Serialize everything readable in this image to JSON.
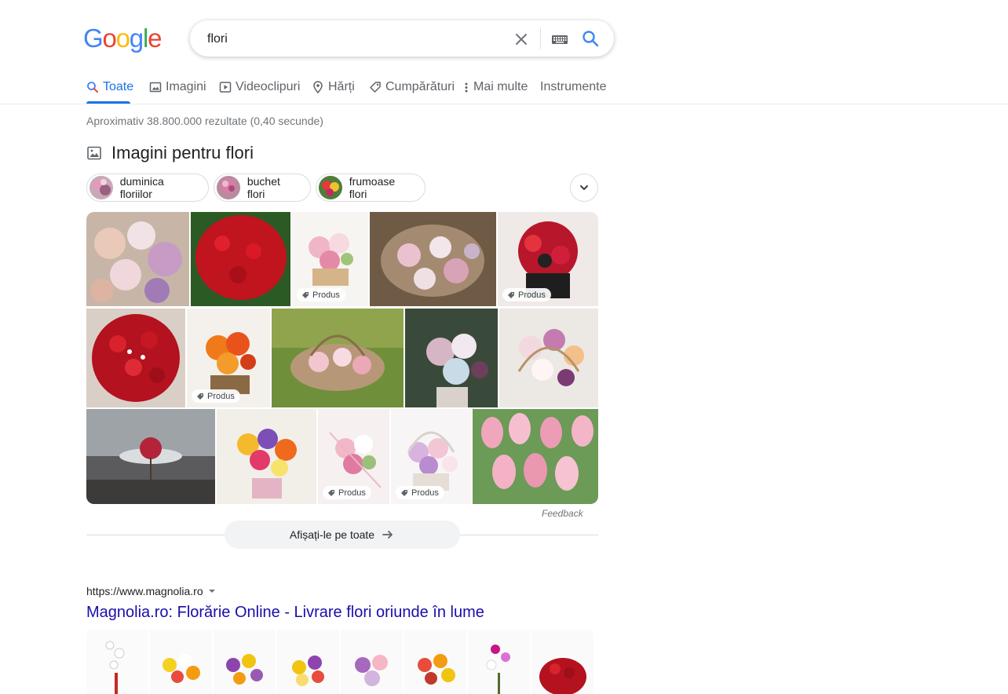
{
  "search": {
    "query": "flori"
  },
  "logo": {
    "text": "Google",
    "colors": [
      "#4285F4",
      "#EA4335",
      "#FBBC05",
      "#4285F4",
      "#34A853",
      "#EA4335"
    ]
  },
  "tabs": [
    {
      "label": "Toate",
      "icon": "search-icon",
      "active": true
    },
    {
      "label": "Imagini",
      "icon": "image-icon"
    },
    {
      "label": "Videoclipuri",
      "icon": "play-icon"
    },
    {
      "label": "Hărți",
      "icon": "map-pin-icon"
    },
    {
      "label": "Cumpărături",
      "icon": "tag-icon"
    },
    {
      "label": "Mai multe",
      "icon": "more-vert-icon"
    },
    {
      "label": "Instrumente"
    }
  ],
  "result_stats": "Aproximativ 38.800.000 rezultate (0,40 secunde)",
  "images_section": {
    "title": "Imagini pentru flori",
    "chips": [
      {
        "label": "duminica floriilor"
      },
      {
        "label": "buchet flori"
      },
      {
        "label": "frumoase flori"
      }
    ],
    "product_badge": "Produs",
    "feedback": "Feedback",
    "show_all": "Afișați-le pe toate"
  },
  "result": {
    "url": "https://www.magnolia.ro",
    "title": "Magnolia.ro: Florărie Online - Livrare flori oriunde în lume"
  },
  "colors": {
    "accent": "#1a73e8",
    "link": "#1a0dab",
    "muted": "#70757a"
  }
}
